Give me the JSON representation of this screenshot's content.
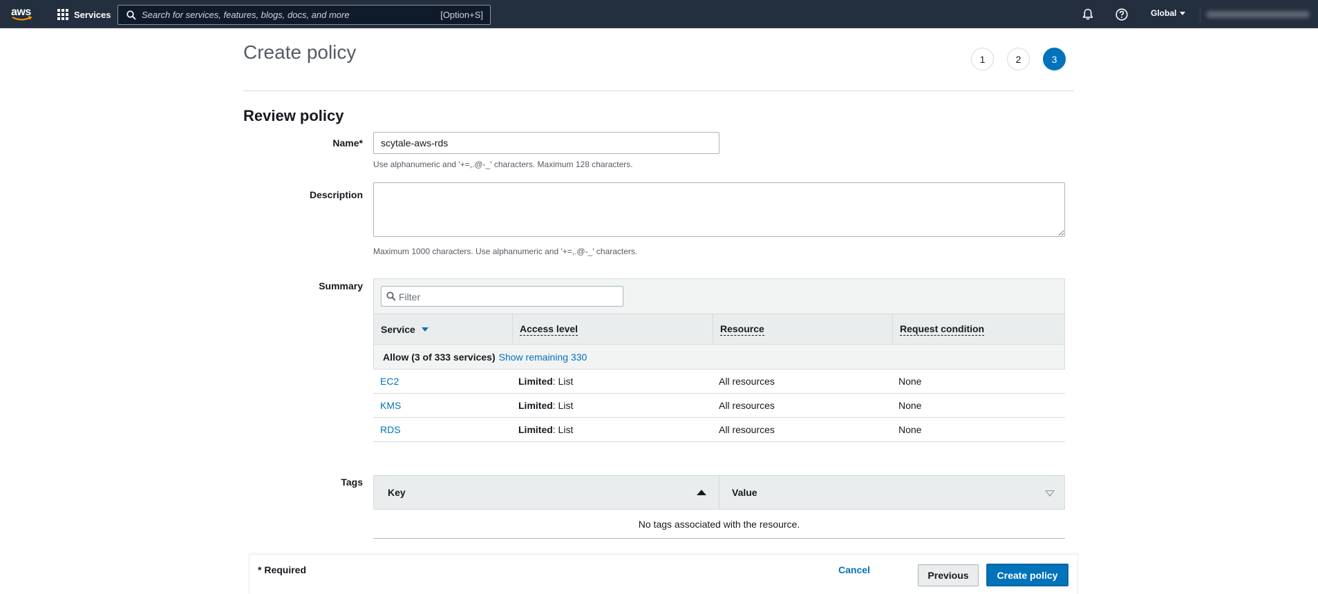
{
  "topnav": {
    "logo_text": "aws",
    "services_label": "Services",
    "search_placeholder": "Search for services, features, blogs, docs, and more",
    "search_shortcut": "[Option+S]",
    "region_label": "Global"
  },
  "header": {
    "title": "Create policy",
    "steps": [
      "1",
      "2",
      "3"
    ],
    "active_step": "3"
  },
  "review": {
    "section_title": "Review policy",
    "name_label": "Name*",
    "name_value": "scytale-aws-rds",
    "name_hint": "Use alphanumeric and '+=,.@-_' characters. Maximum 128 characters.",
    "description_label": "Description",
    "description_value": "",
    "description_hint": "Maximum 1000 characters. Use alphanumeric and '+=,.@-_' characters.",
    "summary_label": "Summary"
  },
  "summary": {
    "filter_placeholder": "Filter",
    "columns": [
      "Service",
      "Access level",
      "Resource",
      "Request condition"
    ],
    "group_text": "Allow (3 of 333 services)",
    "group_link": "Show remaining 330",
    "rows": [
      {
        "service": "EC2",
        "access_bold": "Limited",
        "access_rest": ": List",
        "resource": "All resources",
        "condition": "None"
      },
      {
        "service": "KMS",
        "access_bold": "Limited",
        "access_rest": ": List",
        "resource": "All resources",
        "condition": "None"
      },
      {
        "service": "RDS",
        "access_bold": "Limited",
        "access_rest": ": List",
        "resource": "All resources",
        "condition": "None"
      }
    ]
  },
  "tags": {
    "label": "Tags",
    "key_header": "Key",
    "value_header": "Value",
    "empty_text": "No tags associated with the resource."
  },
  "footer": {
    "required_text": "* Required",
    "cancel_label": "Cancel",
    "previous_label": "Previous",
    "create_label": "Create policy"
  },
  "colors": {
    "nav_bg": "#232f3e",
    "accent": "#0073bb",
    "logo_smile": "#ff9900"
  },
  "icons": [
    "grid-icon",
    "search-icon",
    "bell-icon",
    "help-icon",
    "caret-down-icon",
    "sort-down-icon",
    "sort-up-icon"
  ]
}
